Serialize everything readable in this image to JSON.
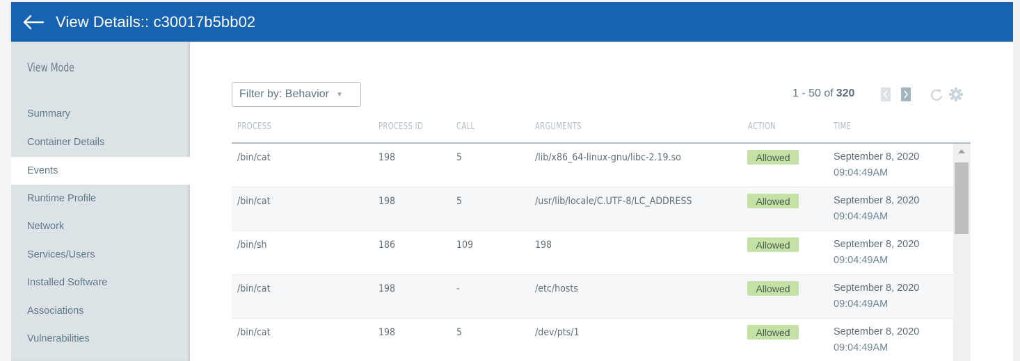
{
  "header": {
    "back_icon": "arrow-left-icon",
    "title": "View Details:: c30017b5bb02"
  },
  "sidebar": {
    "title": "View Mode",
    "active": "Events",
    "items": [
      {
        "label": "Summary"
      },
      {
        "label": "Container Details"
      },
      {
        "label": "Events"
      },
      {
        "label": "Runtime Profile"
      },
      {
        "label": "Network"
      },
      {
        "label": "Services/Users"
      },
      {
        "label": "Installed Software"
      },
      {
        "label": "Associations"
      },
      {
        "label": "Vulnerabilities"
      }
    ]
  },
  "toolbar": {
    "filter_label": "Filter by: Behavior",
    "filter_caret": "▼",
    "pager_range": "1 - 50 of",
    "pager_total": "320",
    "prev_icon": "chevron-left-icon",
    "next_icon": "chevron-right-icon",
    "refresh_icon": "refresh-icon",
    "settings_icon": "gear-icon"
  },
  "table": {
    "columns": [
      "PROCESS",
      "PROCESS ID",
      "CALL",
      "ARGUMENTS",
      "ACTION",
      "TIME"
    ],
    "rows": [
      {
        "process": "/bin/cat",
        "pid": "198",
        "call": "5",
        "args": "/lib/x86_64-linux-gnu/libc-2.19.so",
        "action": "Allowed",
        "date": "September 8, 2020",
        "time": "09:04:49AM"
      },
      {
        "process": "/bin/cat",
        "pid": "198",
        "call": "5",
        "args": "/usr/lib/locale/C.UTF-8/LC_ADDRESS",
        "action": "Allowed",
        "date": "September 8, 2020",
        "time": "09:04:49AM"
      },
      {
        "process": "/bin/sh",
        "pid": "186",
        "call": "109",
        "args": "198",
        "action": "Allowed",
        "date": "September 8, 2020",
        "time": "09:04:49AM"
      },
      {
        "process": "/bin/cat",
        "pid": "198",
        "call": "-",
        "args": "/etc/hosts",
        "action": "Allowed",
        "date": "September 8, 2020",
        "time": "09:04:49AM"
      },
      {
        "process": "/bin/cat",
        "pid": "198",
        "call": "5",
        "args": "/dev/pts/1",
        "action": "Allowed",
        "date": "September 8, 2020",
        "time": "09:04:49AM"
      }
    ]
  },
  "colors": {
    "header_bg": "#1762b1",
    "sidebar_bg": "#dce3e7",
    "allowed_badge": "#c5e1a5"
  }
}
